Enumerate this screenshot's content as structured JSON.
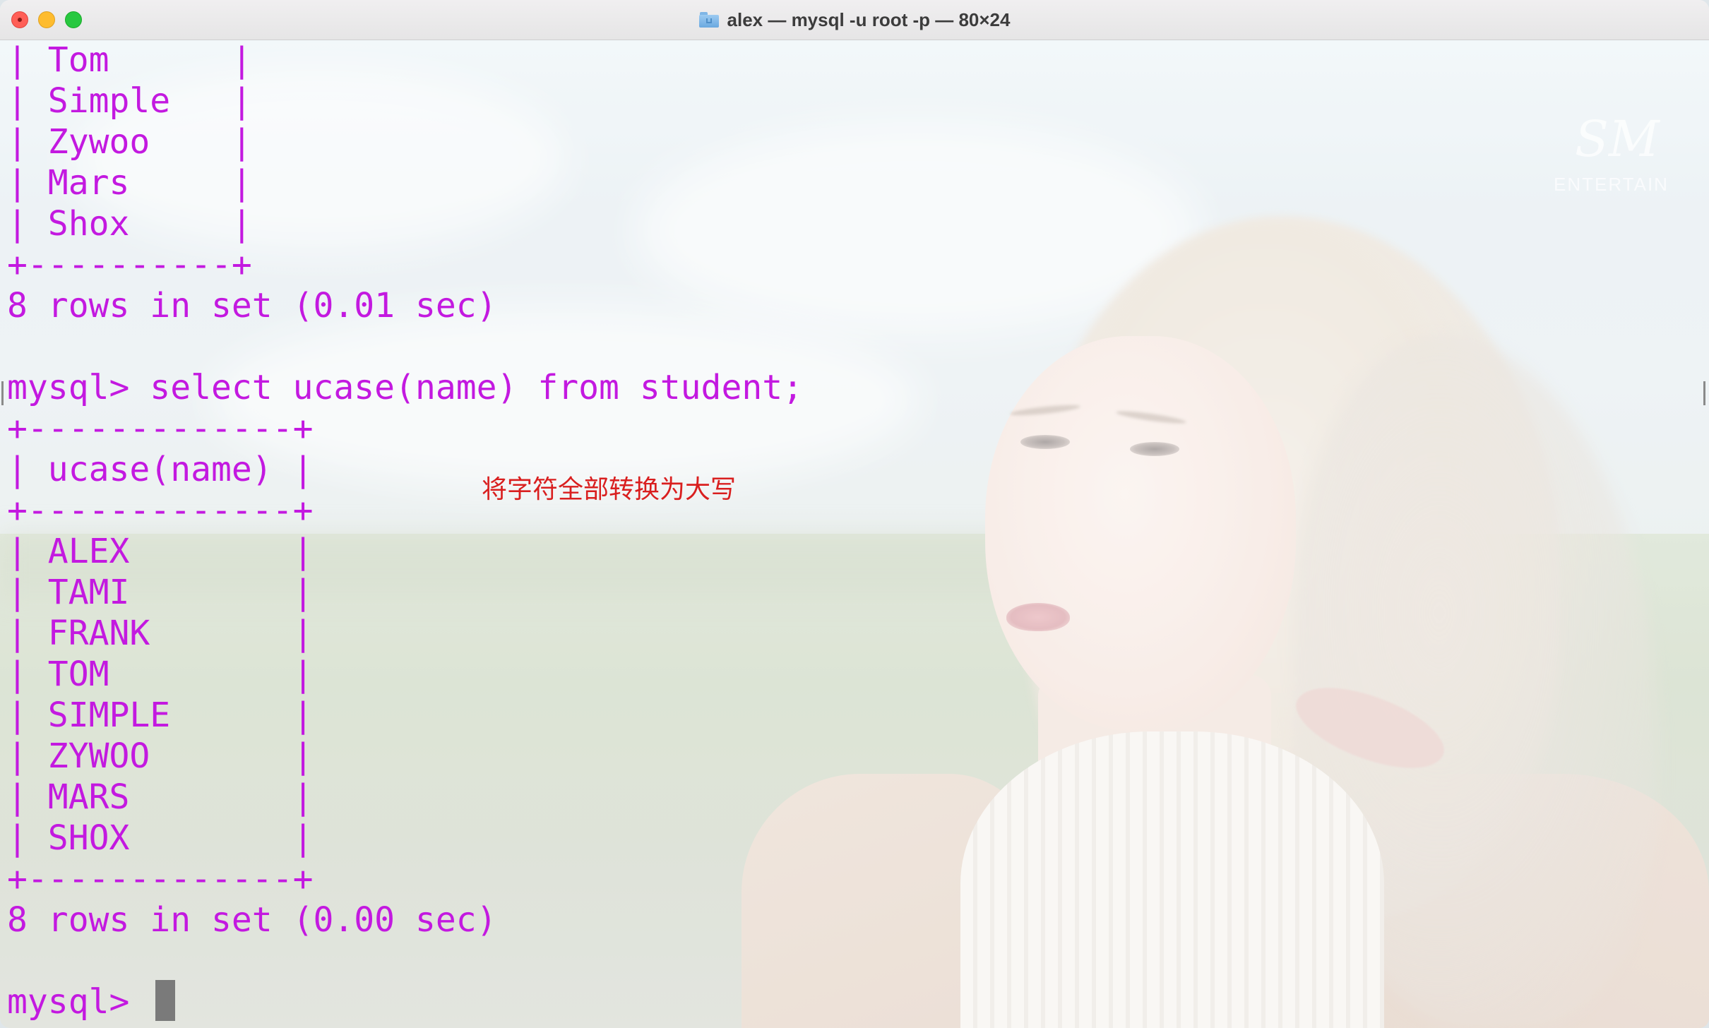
{
  "window": {
    "title": "alex — mysql -u root -p — 80×24",
    "title_icon": "home-folder-icon"
  },
  "background": {
    "watermark": "SM",
    "watermark_sub": "ENTERTAIN"
  },
  "terminal": {
    "lines": [
      "| Tom      |",
      "| Simple   |",
      "| Zywoo    |",
      "| Mars     |",
      "| Shox     |",
      "+----------+",
      "8 rows in set (0.01 sec)",
      "",
      "mysql> select ucase(name) from student;",
      "+-------------+",
      "| ucase(name) |",
      "+-------------+",
      "| ALEX        |",
      "| TAMI        |",
      "| FRANK       |",
      "| TOM         |",
      "| SIMPLE      |",
      "| ZYWOO       |",
      "| MARS        |",
      "| SHOX        |",
      "+-------------+",
      "8 rows in set (0.00 sec)",
      "",
      "mysql> "
    ],
    "text_color": "#c319e0"
  },
  "annotation": {
    "text": "将字符全部转换为大写",
    "color": "#d91f1f"
  }
}
